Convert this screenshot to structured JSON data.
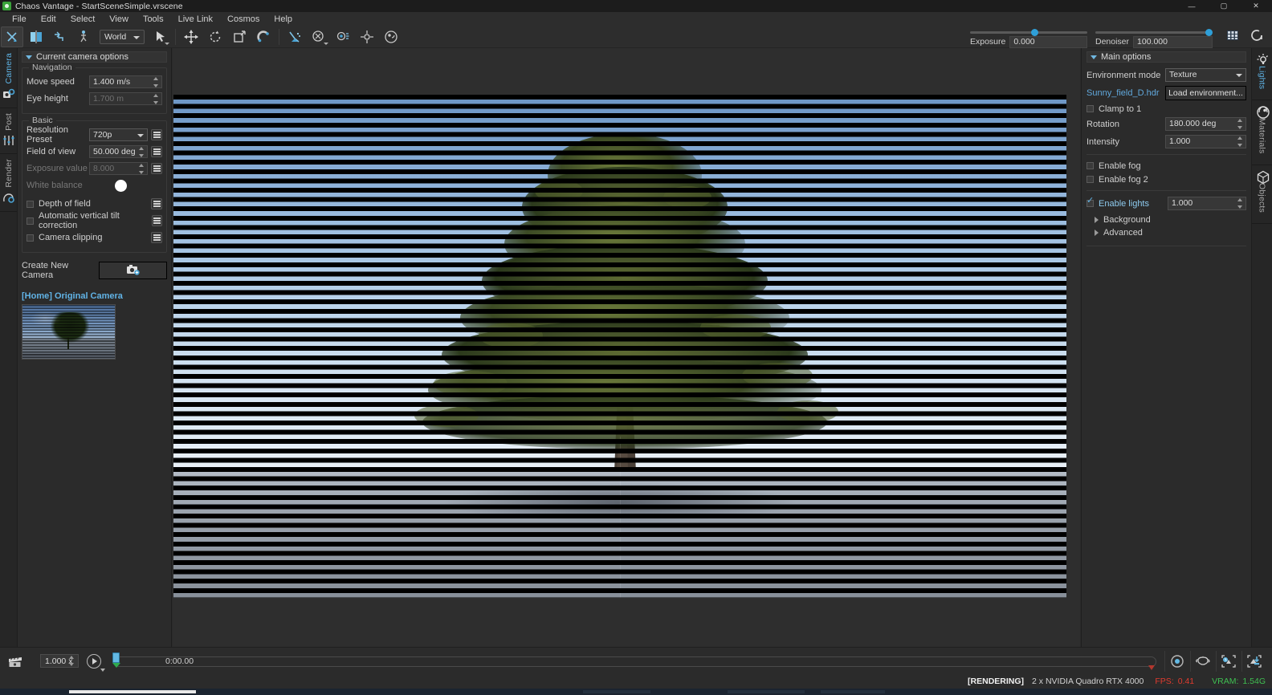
{
  "window": {
    "title": "Chaos Vantage - StartSceneSimple.vrscene",
    "app_icon": "chaos-logo-icon",
    "buttons": {
      "minimize": "—",
      "maximize": "▢",
      "close": "✕"
    }
  },
  "menubar": {
    "items": [
      "File",
      "Edit",
      "Select",
      "View",
      "Tools",
      "Live Link",
      "Cosmos",
      "Help"
    ]
  },
  "toolbar": {
    "icons": [
      "vantage-tool-icon",
      "mirror-split-icon",
      "walk-path-icon",
      "walk-person-icon"
    ],
    "coord_space": {
      "label": "World",
      "icon": "chevron-down-icon"
    },
    "tools": [
      "select-arrow-icon",
      "move-gizmo-icon",
      "rotate-gizmo-icon",
      "scale-gizmo-icon",
      "snap-magnet-icon",
      "vertex-snap-icon",
      "measure-icon",
      "light-tool-icon",
      "pivot-icon",
      "material-picker-icon"
    ],
    "exposure": {
      "label": "Exposure",
      "value": "0.000",
      "slider_pct": 55
    },
    "denoiser": {
      "label": "Denoiser",
      "value": "100.000",
      "slider_pct": 100
    },
    "right_icons": [
      "grid-toggle-icon",
      "refresh-render-icon"
    ]
  },
  "left_rail": {
    "tabs": [
      {
        "label": "Camera",
        "icon": "camera-gear-icon",
        "active": true
      },
      {
        "label": "Post",
        "icon": "sliders-icon",
        "active": false
      },
      {
        "label": "Render",
        "icon": "render-gear-icon",
        "active": false
      }
    ]
  },
  "right_rail": {
    "tabs": [
      {
        "label": "Lights",
        "icon": "light-bulb-icon",
        "active": true
      },
      {
        "label": "Materials",
        "icon": "sphere-icon",
        "active": false
      },
      {
        "label": "Objects",
        "icon": "cube-icon",
        "active": false
      }
    ]
  },
  "camera_panel": {
    "section_title": "Current camera options",
    "navigation": {
      "title": "Navigation",
      "move_speed": {
        "label": "Move speed",
        "value": "1.400 m/s"
      },
      "eye_height": {
        "label": "Eye height",
        "value": "1.700 m",
        "disabled": true
      }
    },
    "basic": {
      "title": "Basic",
      "resolution_preset": {
        "label": "Resolution Preset",
        "value": "720p"
      },
      "field_of_view": {
        "label": "Field of view",
        "value": "50.000 deg"
      },
      "exposure_value": {
        "label": "Exposure value",
        "value": "8.000",
        "disabled": true
      },
      "white_balance": {
        "label": "White balance",
        "color": "#ffffff",
        "disabled": true
      },
      "depth_of_field": {
        "label": "Depth of field",
        "checked": false
      },
      "auto_vertical_tilt": {
        "label": "Automatic vertical tilt correction",
        "checked": false
      },
      "camera_clipping": {
        "label": "Camera clipping",
        "checked": false
      }
    },
    "create_new_camera": {
      "label": "Create New Camera",
      "icon": "camera-plus-icon"
    },
    "saved_camera": {
      "name": "[Home] Original Camera"
    }
  },
  "lights_panel": {
    "section_title": "Main options",
    "environment_mode": {
      "label": "Environment mode",
      "value": "Texture"
    },
    "environment_file": {
      "label": "Sunny_field_D.hdr"
    },
    "load_environment": {
      "label": "Load environment..."
    },
    "clamp_to_1": {
      "label": "Clamp to 1",
      "checked": false
    },
    "rotation": {
      "label": "Rotation",
      "value": "180.000 deg"
    },
    "intensity": {
      "label": "Intensity",
      "value": "1.000"
    },
    "enable_fog": {
      "label": "Enable fog",
      "checked": false
    },
    "enable_fog_2": {
      "label": "Enable fog 2",
      "checked": false
    },
    "enable_lights": {
      "label": "Enable lights",
      "checked": true,
      "value": "1.000"
    },
    "background": {
      "label": "Background"
    },
    "advanced": {
      "label": "Advanced"
    }
  },
  "timeline": {
    "clapper_icon": "clapperboard-icon",
    "speed": {
      "value": "1.000 x"
    },
    "play_button": "play-icon",
    "current_time": "0:00.00",
    "right_icons": [
      "record-keyframe-icon",
      "teapot-icon",
      "time-snapshot-icon",
      "save-snapshot-icon"
    ]
  },
  "statusbar": {
    "render_state": "[RENDERING]",
    "gpu": "2 x NVIDIA Quadro RTX 4000",
    "fps_label": "FPS:",
    "fps_value": "0.41",
    "vram_label": "VRAM:",
    "vram_value": "1.54G"
  },
  "colors": {
    "accent": "#62b4e6",
    "link": "#61a8dc",
    "panel_bg": "#2b2b2b",
    "titlebar_bg": "#1c1c1c",
    "fps_red": "#e03b2f",
    "vram_green": "#3fbf52"
  }
}
